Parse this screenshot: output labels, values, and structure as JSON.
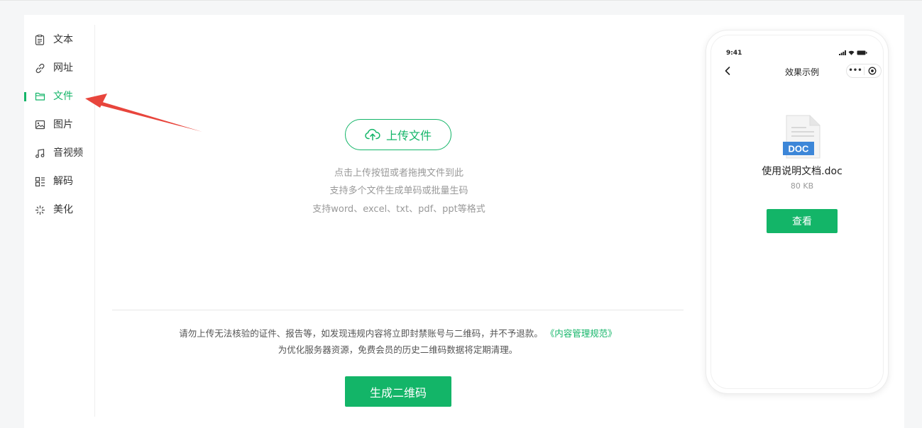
{
  "sidebar": {
    "items": [
      {
        "label": "文本",
        "icon": "text-doc-icon"
      },
      {
        "label": "网址",
        "icon": "link-icon"
      },
      {
        "label": "文件",
        "icon": "folder-icon"
      },
      {
        "label": "图片",
        "icon": "image-icon"
      },
      {
        "label": "音视频",
        "icon": "music-note-icon"
      },
      {
        "label": "解码",
        "icon": "qr-decode-icon"
      },
      {
        "label": "美化",
        "icon": "sparkle-icon"
      }
    ],
    "active_index": 2
  },
  "upload": {
    "button_label": "上传文件",
    "hints": [
      "点击上传按钮或者拖拽文件到此",
      "支持多个文件生成单码或批量生码",
      "支持word、excel、txt、pdf、ppt等格式"
    ]
  },
  "notice": {
    "line1": "请勿上传无法核验的证件、报告等，如发现违规内容将立即封禁账号与二维码，并不予退款。",
    "policy_link": "《内容管理规范》",
    "line2": "为优化服务器资源，免费会员的历史二维码数据将定期清理。"
  },
  "generate_button": "生成二维码",
  "preview": {
    "time": "9:41",
    "title": "效果示例",
    "capsule_dots": "•••",
    "doc_badge": "DOC",
    "file_name": "使用说明文档.doc",
    "file_size": "80 KB",
    "view_button": "查看"
  },
  "colors": {
    "accent": "#13b568",
    "annotation_arrow": "#e8453c",
    "doc_badge": "#3c86d8"
  }
}
